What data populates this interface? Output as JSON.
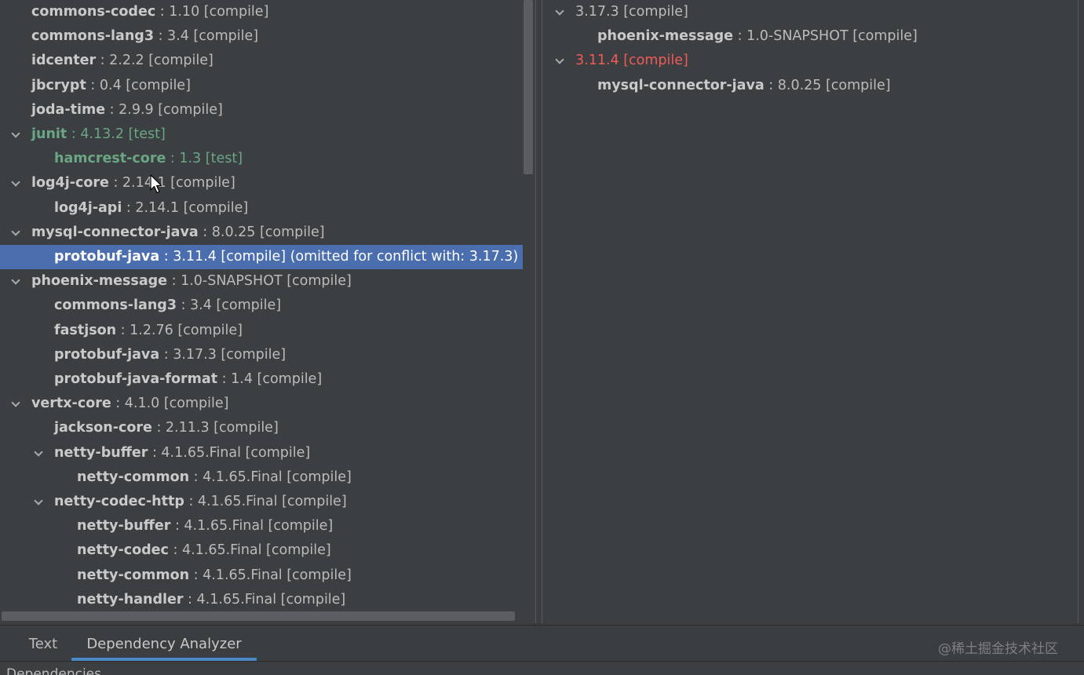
{
  "left_tree": [
    {
      "name": "commons-codec",
      "sep": " : ",
      "version": "1.10 [compile]",
      "indent": 0,
      "expanded": null,
      "style": "normal"
    },
    {
      "name": "commons-lang3",
      "sep": " : ",
      "version": "3.4 [compile]",
      "indent": 0,
      "expanded": null,
      "style": "normal"
    },
    {
      "name": "idcenter",
      "sep": " : ",
      "version": "2.2.2 [compile]",
      "indent": 0,
      "expanded": null,
      "style": "normal"
    },
    {
      "name": "jbcrypt",
      "sep": " : ",
      "version": "0.4 [compile]",
      "indent": 0,
      "expanded": null,
      "style": "normal"
    },
    {
      "name": "joda-time",
      "sep": " : ",
      "version": "2.9.9 [compile]",
      "indent": 0,
      "expanded": null,
      "style": "normal"
    },
    {
      "name": "junit",
      "sep": " : ",
      "version": "4.13.2 [test]",
      "indent": 0,
      "expanded": true,
      "style": "test"
    },
    {
      "name": "hamcrest-core",
      "sep": " : ",
      "version": "1.3 [test]",
      "indent": 1,
      "expanded": null,
      "style": "test"
    },
    {
      "name": "log4j-core",
      "sep": " : ",
      "version": "2.14.1 [compile]",
      "indent": 0,
      "expanded": true,
      "style": "normal"
    },
    {
      "name": "log4j-api",
      "sep": " : ",
      "version": "2.14.1 [compile]",
      "indent": 1,
      "expanded": null,
      "style": "normal"
    },
    {
      "name": "mysql-connector-java",
      "sep": " : ",
      "version": "8.0.25 [compile]",
      "indent": 0,
      "expanded": true,
      "style": "normal"
    },
    {
      "name": "protobuf-java",
      "sep": " : ",
      "version": "3.11.4 [compile] (omitted for conflict with: 3.17.3)",
      "indent": 1,
      "expanded": null,
      "style": "selected"
    },
    {
      "name": "phoenix-message",
      "sep": " : ",
      "version": "1.0-SNAPSHOT [compile]",
      "indent": 0,
      "expanded": true,
      "style": "normal"
    },
    {
      "name": "commons-lang3",
      "sep": " : ",
      "version": "3.4 [compile]",
      "indent": 1,
      "expanded": null,
      "style": "normal"
    },
    {
      "name": "fastjson",
      "sep": " : ",
      "version": "1.2.76 [compile]",
      "indent": 1,
      "expanded": null,
      "style": "normal"
    },
    {
      "name": "protobuf-java",
      "sep": " : ",
      "version": "3.17.3 [compile]",
      "indent": 1,
      "expanded": null,
      "style": "normal"
    },
    {
      "name": "protobuf-java-format",
      "sep": " : ",
      "version": "1.4 [compile]",
      "indent": 1,
      "expanded": null,
      "style": "normal"
    },
    {
      "name": "vertx-core",
      "sep": " : ",
      "version": "4.1.0 [compile]",
      "indent": 0,
      "expanded": true,
      "style": "normal"
    },
    {
      "name": "jackson-core",
      "sep": " : ",
      "version": "2.11.3 [compile]",
      "indent": 1,
      "expanded": null,
      "style": "normal"
    },
    {
      "name": "netty-buffer",
      "sep": " : ",
      "version": "4.1.65.Final [compile]",
      "indent": 1,
      "expanded": true,
      "style": "normal"
    },
    {
      "name": "netty-common",
      "sep": " : ",
      "version": "4.1.65.Final [compile]",
      "indent": 2,
      "expanded": null,
      "style": "normal"
    },
    {
      "name": "netty-codec-http",
      "sep": " : ",
      "version": "4.1.65.Final [compile]",
      "indent": 1,
      "expanded": true,
      "style": "normal"
    },
    {
      "name": "netty-buffer",
      "sep": " : ",
      "version": "4.1.65.Final [compile]",
      "indent": 2,
      "expanded": null,
      "style": "normal"
    },
    {
      "name": "netty-codec",
      "sep": " : ",
      "version": "4.1.65.Final [compile]",
      "indent": 2,
      "expanded": null,
      "style": "normal"
    },
    {
      "name": "netty-common",
      "sep": " : ",
      "version": "4.1.65.Final [compile]",
      "indent": 2,
      "expanded": null,
      "style": "normal"
    },
    {
      "name": "netty-handler",
      "sep": " : ",
      "version": "4.1.65.Final [compile]",
      "indent": 2,
      "expanded": null,
      "style": "normal"
    }
  ],
  "right_tree": [
    {
      "name": "",
      "sep": "",
      "version": "3.17.3 [compile]",
      "indent": 0,
      "expanded": true,
      "style": "normal"
    },
    {
      "name": "phoenix-message",
      "sep": " : ",
      "version": "1.0-SNAPSHOT [compile]",
      "indent": 1,
      "expanded": null,
      "style": "normal"
    },
    {
      "name": "",
      "sep": "",
      "version": "3.11.4 [compile]",
      "indent": 0,
      "expanded": true,
      "style": "conflict"
    },
    {
      "name": "mysql-connector-java",
      "sep": " : ",
      "version": "8.0.25 [compile]",
      "indent": 1,
      "expanded": null,
      "style": "normal"
    }
  ],
  "tabs": {
    "text": "Text",
    "dependency_analyzer": "Dependency Analyzer",
    "active": "dependency_analyzer"
  },
  "watermark": "@稀土掘金技术社区",
  "status_text": "Dependencies",
  "icons": {
    "expand": "chevron-down-icon",
    "pointer": "mouse-pointer-icon"
  },
  "colors": {
    "selection": "#4b6eaf",
    "test_scope": "#6aa585",
    "conflict": "#ef5b59",
    "active_tab_underline": "#4a88c7"
  }
}
